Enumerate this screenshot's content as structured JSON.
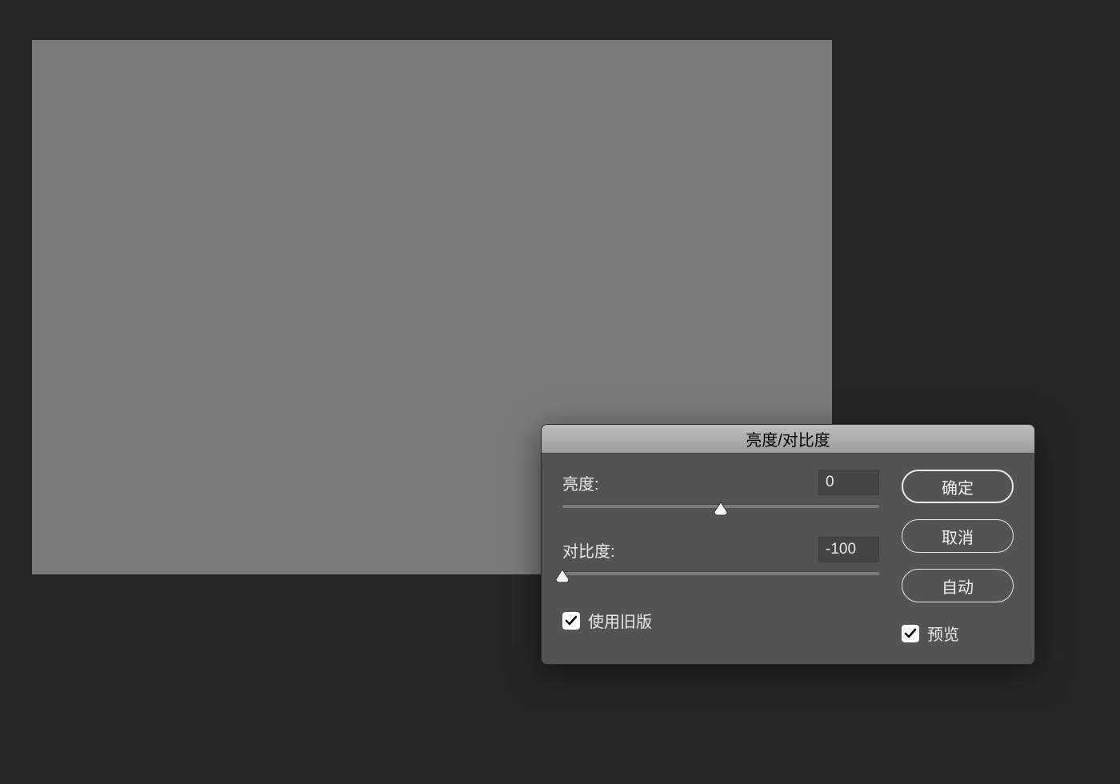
{
  "dialog": {
    "title": "亮度/对比度",
    "brightness": {
      "label": "亮度:",
      "value": "0",
      "percent": 50
    },
    "contrast": {
      "label": "对比度:",
      "value": "-100",
      "percent": 0
    },
    "legacy": {
      "label": "使用旧版",
      "checked": true
    },
    "buttons": {
      "ok": "确定",
      "cancel": "取消",
      "auto": "自动"
    },
    "preview": {
      "label": "预览",
      "checked": true
    }
  }
}
